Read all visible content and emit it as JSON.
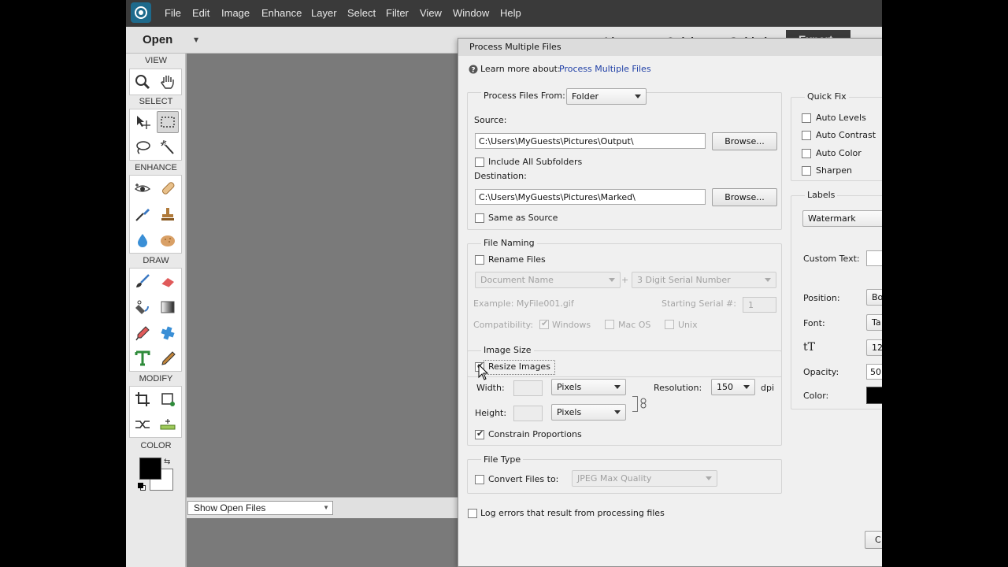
{
  "menubar": {
    "items": [
      "File",
      "Edit",
      "Image",
      "Enhance",
      "Layer",
      "Select",
      "Filter",
      "View",
      "Window",
      "Help"
    ]
  },
  "optbar": {
    "open_label": "Open",
    "tabs": [
      "eLive",
      "Quick",
      "Guided",
      "Expert"
    ]
  },
  "toolbox": {
    "sections": [
      "VIEW",
      "SELECT",
      "ENHANCE",
      "DRAW",
      "MODIFY",
      "COLOR"
    ]
  },
  "bin": {
    "select_value": "Show Open Files"
  },
  "dialog": {
    "title": "Process Multiple Files",
    "learn_prefix": "Learn more about:",
    "learn_link": "Process Multiple Files",
    "process_from_label": "Process Files From:",
    "process_from_value": "Folder",
    "source_label": "Source:",
    "source_path": "C:\\Users\\MyGuests\\Pictures\\Output\\",
    "browse_label": "Browse...",
    "include_subfolders": "Include All Subfolders",
    "destination_label": "Destination:",
    "destination_path": "C:\\Users\\MyGuests\\Pictures\\Marked\\",
    "same_as_source": "Same as Source",
    "file_naming": {
      "legend": "File Naming",
      "rename_files": "Rename Files",
      "name_option1": "Document Name",
      "plus": "+",
      "name_option2": "3 Digit Serial Number",
      "example": "Example: MyFile001.gif",
      "starting_serial_label": "Starting Serial #:",
      "starting_serial_value": "1",
      "compatibility_label": "Compatibility:",
      "compat_windows": "Windows",
      "compat_macos": "Mac OS",
      "compat_unix": "Unix"
    },
    "image_size": {
      "legend": "Image Size",
      "resize_images": "Resize Images",
      "width_label": "Width:",
      "height_label": "Height:",
      "unit": "Pixels",
      "resolution_label": "Resolution:",
      "resolution_value": "150",
      "dpi": "dpi",
      "constrain": "Constrain Proportions"
    },
    "file_type": {
      "legend": "File Type",
      "convert_label": "Convert Files to:",
      "convert_value": "JPEG Max Quality"
    },
    "log_errors": "Log errors that result from processing files",
    "quick_fix": {
      "legend": "Quick Fix",
      "items": [
        "Auto Levels",
        "Auto Contrast",
        "Auto Color",
        "Sharpen"
      ]
    },
    "labels": {
      "legend": "Labels",
      "type_value": "Watermark",
      "custom_text_label": "Custom Text:",
      "position_label": "Position:",
      "position_value": "Bo",
      "font_label": "Font:",
      "font_value": "Ta",
      "size_value": "12",
      "opacity_label": "Opacity:",
      "opacity_value": "50",
      "color_label": "Color:",
      "color_value": "#000000"
    },
    "cancel_partial": "C"
  }
}
